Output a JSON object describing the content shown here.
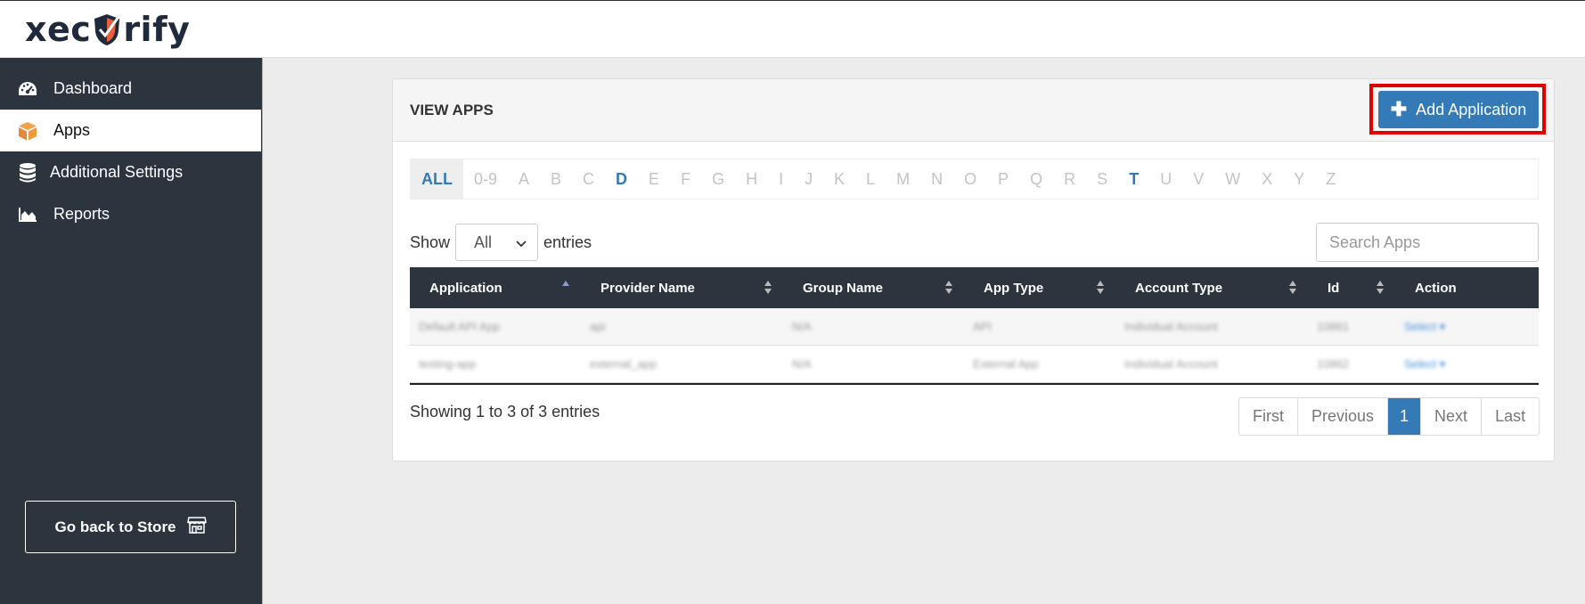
{
  "app": {
    "logo_text_left": "xec",
    "logo_text_right": "rify"
  },
  "sidebar": {
    "items": [
      {
        "label": "Dashboard",
        "icon": "dashboard-icon"
      },
      {
        "label": "Apps",
        "icon": "cube-icon"
      },
      {
        "label": "Additional Settings",
        "icon": "database-icon"
      },
      {
        "label": "Reports",
        "icon": "area-chart-icon"
      }
    ],
    "active_index": 1,
    "store_button": "Go back to Store",
    "store_icon": "store-icon"
  },
  "panel": {
    "title": "VIEW APPS",
    "add_button": "Add Application"
  },
  "alpha_filter": {
    "letters": [
      "ALL",
      "0-9",
      "A",
      "B",
      "C",
      "D",
      "E",
      "F",
      "G",
      "H",
      "I",
      "J",
      "K",
      "L",
      "M",
      "N",
      "O",
      "P",
      "Q",
      "R",
      "S",
      "T",
      "U",
      "V",
      "W",
      "X",
      "Y",
      "Z"
    ],
    "selected": "ALL",
    "available": [
      "D",
      "T"
    ]
  },
  "entries": {
    "show_label": "Show",
    "selected": "All",
    "suffix": "entries"
  },
  "search": {
    "placeholder": "Search Apps"
  },
  "table": {
    "columns": [
      "Application",
      "Provider Name",
      "Group Name",
      "App Type",
      "Account Type",
      "Id",
      "Action"
    ],
    "rows": [
      [
        "Default API App",
        "api",
        "N/A",
        "API",
        "Individual Account",
        "10861",
        "Select ▾"
      ],
      [
        "testing-app",
        "external_app",
        "N/A",
        "External App",
        "Individual Account",
        "10862",
        "Select ▾"
      ]
    ]
  },
  "footer": {
    "info": "Showing 1 to 3 of 3 entries",
    "pager": [
      "First",
      "Previous",
      "1",
      "Next",
      "Last"
    ],
    "current_page": "1"
  },
  "colors": {
    "sidebar_bg": "#2c343d",
    "accent": "#337ab7",
    "highlight": "#e00000",
    "logo_orange": "#e8603c"
  }
}
